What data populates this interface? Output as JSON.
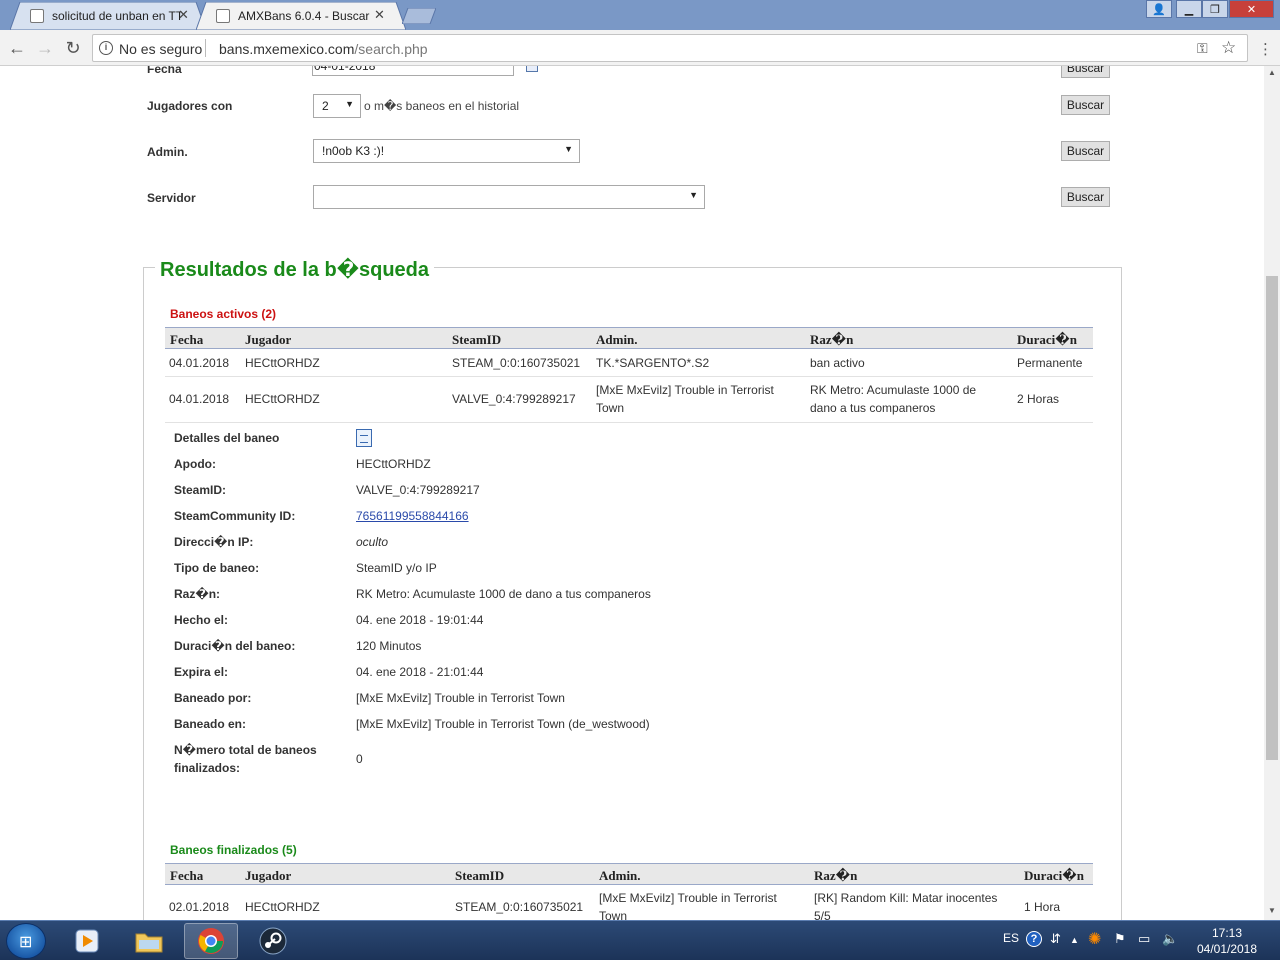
{
  "browser": {
    "tabs": [
      {
        "title": "solicitud de unban en TTT"
      },
      {
        "title": "AMXBans 6.0.4 - Buscar"
      }
    ],
    "security_label": "No es seguro",
    "url_host": "bans.mxemexico.com",
    "url_path": "/search.php"
  },
  "form": {
    "fecha_label": "Fecha",
    "fecha_value": "04-01-2018",
    "jugadores_label": "Jugadores con",
    "jugadores_value": "2",
    "jugadores_suffix": "o m�s baneos en el historial",
    "admin_label": "Admin.",
    "admin_value": "!n0ob K3 :)!",
    "servidor_label": "Servidor",
    "servidor_value": "",
    "buscar_label": "Buscar"
  },
  "results": {
    "title": "Resultados de la b�squeda",
    "active": {
      "heading": "Baneos activos (2)",
      "columns": [
        "Fecha",
        "Jugador",
        "SteamID",
        "Admin.",
        "Raz�n",
        "Duraci�n"
      ],
      "rows": [
        {
          "fecha": "04.01.2018",
          "jugador": "HECttORHDZ",
          "steamid": "STEAM_0:0:160735021",
          "admin": "TK.*SARGENTO*.S2",
          "razon": "ban activo",
          "duracion": "Permanente"
        },
        {
          "fecha": "04.01.2018",
          "jugador": "HECttORHDZ",
          "steamid": "VALVE_0:4:799289217",
          "admin": "[MxE MxEvilz] Trouble in Terrorist Town",
          "razon": "RK Metro: Acumulaste 1000 de dano a tus companeros",
          "duracion": "2 Horas"
        }
      ]
    },
    "details": [
      {
        "label": "Detalles del baneo",
        "value": ""
      },
      {
        "label": "Apodo:",
        "value": "HECttORHDZ"
      },
      {
        "label": "SteamID:",
        "value": "VALVE_0:4:799289217"
      },
      {
        "label": "SteamCommunity ID:",
        "value": "76561199558844166"
      },
      {
        "label": "Direcci�n IP:",
        "value": "oculto"
      },
      {
        "label": "Tipo de baneo:",
        "value": "SteamID y/o IP"
      },
      {
        "label": "Raz�n:",
        "value": "RK Metro: Acumulaste 1000 de dano a tus companeros"
      },
      {
        "label": "Hecho el:",
        "value": "04. ene 2018 - 19:01:44"
      },
      {
        "label": "Duraci�n del baneo:",
        "value": "120 Minutos"
      },
      {
        "label": "Expira el:",
        "value": "04. ene 2018 - 21:01:44"
      },
      {
        "label": "Baneado por:",
        "value": "[MxE MxEvilz] Trouble in Terrorist Town"
      },
      {
        "label": "Baneado en:",
        "value": "[MxE MxEvilz] Trouble in Terrorist Town (de_westwood)"
      },
      {
        "label": "N�mero total de baneos finalizados:",
        "value": "0"
      }
    ],
    "finished": {
      "heading": "Baneos finalizados (5)",
      "columns": [
        "Fecha",
        "Jugador",
        "SteamID",
        "Admin.",
        "Raz�n",
        "Duraci�n"
      ],
      "rows": [
        {
          "fecha": "02.01.2018",
          "jugador": "HECttORHDZ",
          "steamid": "STEAM_0:0:160735021",
          "admin": "[MxE MxEvilz] Trouble in Terrorist Town",
          "razon": "[RK] Random Kill: Matar inocentes 5/5",
          "duracion": "1 Hora"
        }
      ]
    }
  },
  "taskbar": {
    "language": "ES",
    "time": "17:13",
    "date": "04/01/2018"
  }
}
